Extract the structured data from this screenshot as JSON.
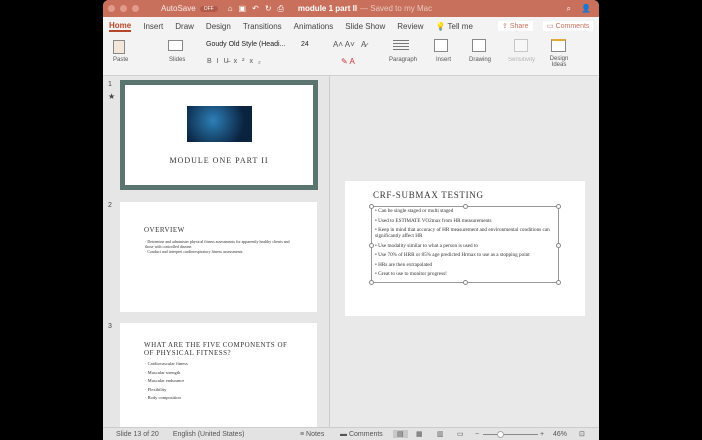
{
  "titlebar": {
    "autosave": "AutoSave",
    "autosave_state": "OFF",
    "doc_title": "module 1 part II",
    "saved": "— Saved to my Mac"
  },
  "tabs": [
    "Home",
    "Insert",
    "Draw",
    "Design",
    "Transitions",
    "Animations",
    "Slide Show",
    "Review"
  ],
  "tell_me": "Tell me",
  "share": "Share",
  "comments": "Comments",
  "ribbon": {
    "paste": "Paste",
    "slides": "Slides",
    "font": "Goudy Old Style (Headi...",
    "size": "24",
    "paragraph": "Paragraph",
    "insert": "Insert",
    "drawing": "Drawing",
    "sensitivity": "Sensitivity",
    "design_ideas": "Design Ideas"
  },
  "thumbs": [
    {
      "num": "1",
      "title": "MODULE ONE PART II"
    },
    {
      "num": "2",
      "title": "OVERVIEW",
      "bullets": [
        "Determine and administer physical fitness assessments for apparently healthy clients and those with controlled disease.",
        "Conduct and interpret cardiorespiratory fitness assessments."
      ]
    },
    {
      "num": "3",
      "title": "WHAT ARE THE FIVE COMPONENTS OF OF PHYSICAL FITNESS?",
      "bullets": [
        "Cardiovascular fitness",
        "Muscular strength",
        "Muscular endurance",
        "Flexibility",
        "Body composition"
      ]
    }
  ],
  "slide": {
    "title": "CRF-SUBMAX TESTING",
    "bullets": [
      "Can be single staged or multi staged",
      "Used to ESTIMATE VO2max from HR measurements",
      "Keep in mind that accuracy of HR measurement and environmental conditions can significantly affect HR",
      "Use modality similar to what a person is used to",
      "Use 70% of HRR or 85% age predicted Hrmax to use as a stopping point",
      "HRs are then extrapolated",
      "Great to use to monitor progress!"
    ]
  },
  "status": {
    "slide": "Slide 13 of 20",
    "language": "English (United States)",
    "notes": "Notes",
    "comments": "Comments",
    "zoom": "46%"
  },
  "colors": {
    "accent": "#c8705c",
    "thumb1_border": "#5a7470"
  }
}
